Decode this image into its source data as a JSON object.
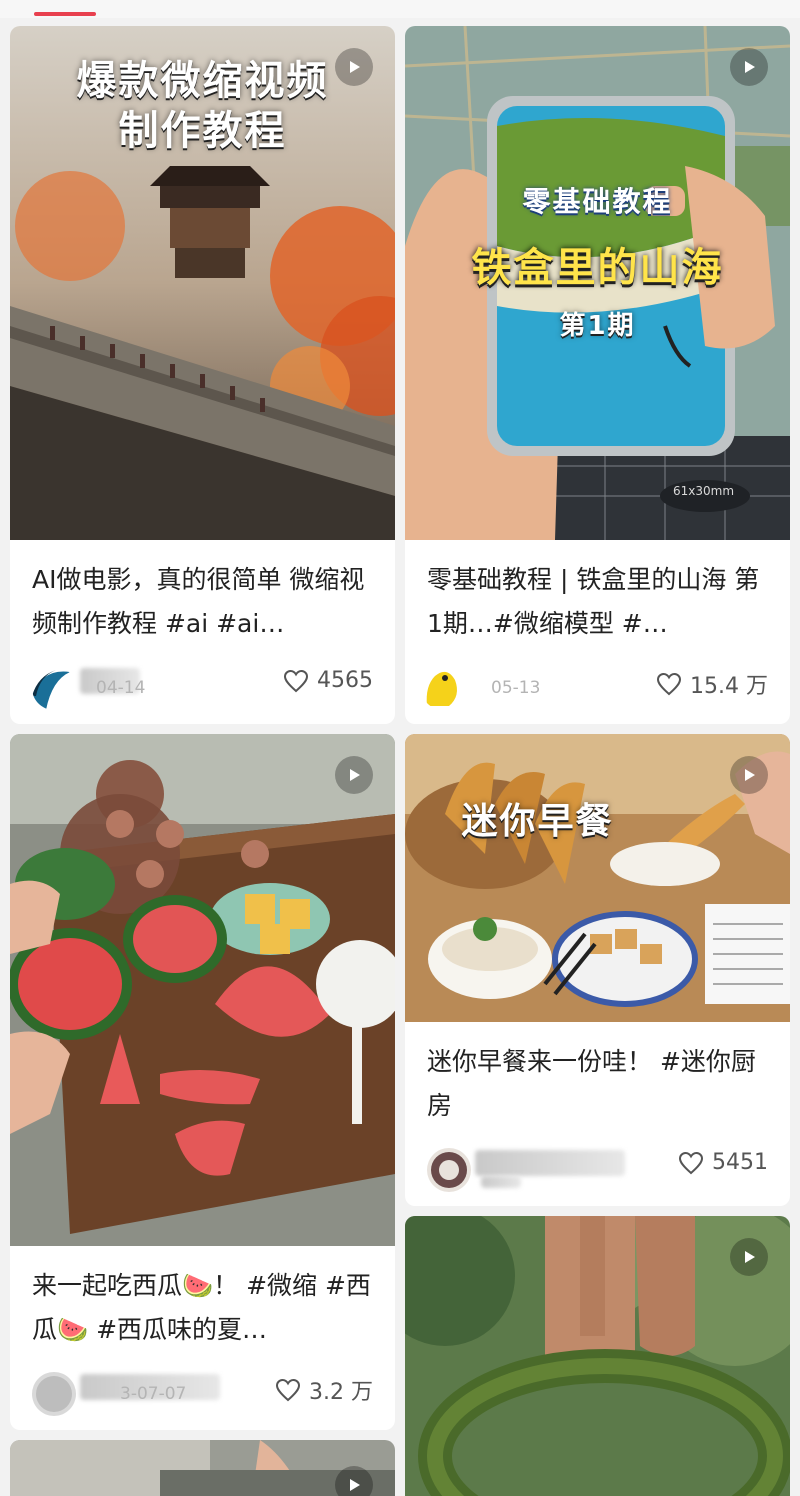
{
  "feed": {
    "cards": [
      {
        "overlay_lines": [
          "爆款微缩视频",
          "制作教程"
        ],
        "title": "AI做电影，真的很简单 微缩视频制作教程 #ai  #ai…",
        "date": "04-14",
        "likes": "4565"
      },
      {
        "overlay_lines": [
          "零基础教程",
          "铁盒里的山海",
          "第1期"
        ],
        "title": "零基础教程 | 铁盒里的山海 第1期…#微缩模型 #…",
        "date": "05-13",
        "likes": "15.4 万",
        "cutting_mat_label": "61x30mm"
      },
      {
        "overlay_lines": [],
        "title": "来一起吃西瓜🍉！ #微缩 #西瓜🍉 #西瓜味的夏…",
        "date": "3-07-07",
        "likes": "3.2 万"
      },
      {
        "overlay_lines": [
          "迷你早餐"
        ],
        "title": "迷你早餐来一份哇！ #迷你厨房",
        "date": "",
        "likes": "5451"
      },
      {
        "overlay_lines": [],
        "title": "",
        "date": "",
        "likes": ""
      },
      {
        "overlay_lines": [],
        "title": "",
        "date": "",
        "likes": ""
      }
    ]
  },
  "icons": {
    "play": "play-icon",
    "like": "heart-outline-icon"
  },
  "colors": {
    "accent": "#e8404e",
    "background": "#f2f2f2",
    "card": "#ffffff"
  }
}
